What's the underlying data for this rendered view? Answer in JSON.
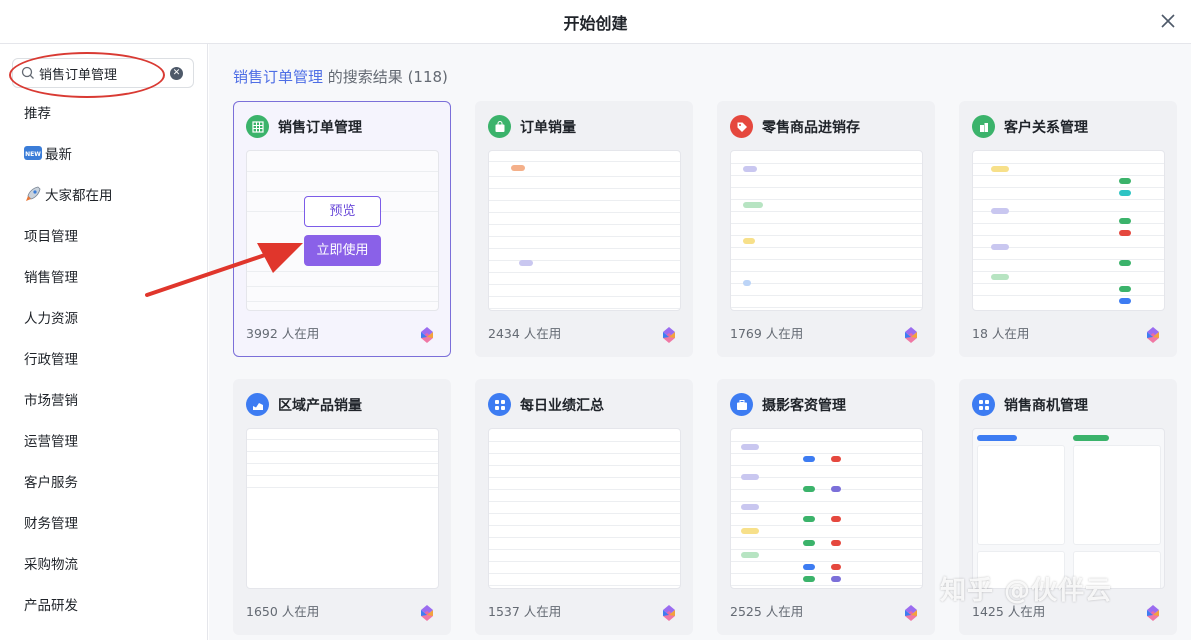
{
  "dialog": {
    "title": "开始创建"
  },
  "search": {
    "value": "销售订单管理"
  },
  "sidebar": {
    "items": [
      {
        "label": "推荐",
        "emoji": ""
      },
      {
        "label": "最新",
        "emoji": "new"
      },
      {
        "label": "大家都在用",
        "emoji": "rocket"
      },
      {
        "label": "项目管理",
        "emoji": ""
      },
      {
        "label": "销售管理",
        "emoji": ""
      },
      {
        "label": "人力资源",
        "emoji": ""
      },
      {
        "label": "行政管理",
        "emoji": ""
      },
      {
        "label": "市场营销",
        "emoji": ""
      },
      {
        "label": "运营管理",
        "emoji": ""
      },
      {
        "label": "客户服务",
        "emoji": ""
      },
      {
        "label": "财务管理",
        "emoji": ""
      },
      {
        "label": "采购物流",
        "emoji": ""
      },
      {
        "label": "产品研发",
        "emoji": ""
      }
    ]
  },
  "results": {
    "keyword": "销售订单管理",
    "suffix": "的搜索结果 (118)"
  },
  "cards": [
    {
      "name": "销售订单管理",
      "users": "3992 人在用",
      "icon": "grid-icon",
      "color": "#3bb36b",
      "selected": true
    },
    {
      "name": "订单销量",
      "users": "2434 人在用",
      "icon": "bag-icon",
      "color": "#3bb36b"
    },
    {
      "name": "零售商品进销存",
      "users": "1769 人在用",
      "icon": "tag-icon",
      "color": "#e5483e"
    },
    {
      "name": "客户关系管理",
      "users": "18 人在用",
      "icon": "building-icon",
      "color": "#3bb36b"
    },
    {
      "name": "区域产品销量",
      "users": "1650 人在用",
      "icon": "chart-icon",
      "color": "#3d7cf2"
    },
    {
      "name": "每日业绩汇总",
      "users": "1537 人在用",
      "icon": "grid4-icon",
      "color": "#3d7cf2"
    },
    {
      "name": "摄影客资管理",
      "users": "2525 人在用",
      "icon": "briefcase-icon",
      "color": "#3d7cf2"
    },
    {
      "name": "销售商机管理",
      "users": "1425 人在用",
      "icon": "grid4-icon",
      "color": "#3d7cf2"
    }
  ],
  "overlay": {
    "preview_label": "预览",
    "use_label": "立即使用"
  },
  "watermark": "知乎 @伙伴云",
  "colors": {
    "accent": "#8a61e8",
    "annotation": "#d93a33",
    "link": "#4e6ee5"
  }
}
